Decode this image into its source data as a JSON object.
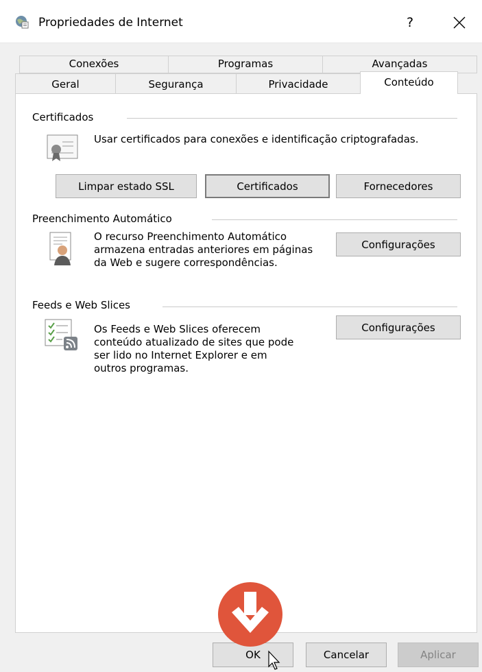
{
  "window": {
    "title": "Propriedades de Internet",
    "help": "?",
    "close": "✕"
  },
  "tabs": {
    "row1": [
      "Conexões",
      "Programas",
      "Avançadas"
    ],
    "row2": [
      "Geral",
      "Segurança",
      "Privacidade",
      "Conteúdo"
    ],
    "active": "Conteúdo"
  },
  "certificates": {
    "title": "Certificados",
    "description": "Usar certificados para conexões e identificação criptografadas.",
    "buttons": {
      "clear_ssl": "Limpar estado SSL",
      "certificates": "Certificados",
      "publishers": "Fornecedores"
    }
  },
  "autocomplete": {
    "title": "Preenchimento Automático",
    "description_lines": [
      "O recurso Preenchimento Automático",
      "armazena entradas anteriores em páginas",
      "da Web e sugere correspondências."
    ],
    "settings_button": "Configurações"
  },
  "feeds": {
    "title": "Feeds e Web Slices",
    "description_lines": [
      "Os Feeds e Web Slices oferecem",
      "conteúdo atualizado de sites que pode",
      "ser lido no Internet Explorer e em",
      "outros programas."
    ],
    "settings_button": "Configurações"
  },
  "footer": {
    "ok": "OK",
    "cancel": "Cancelar",
    "apply": "Aplicar"
  },
  "colors": {
    "accent_badge": "#e0553b"
  }
}
